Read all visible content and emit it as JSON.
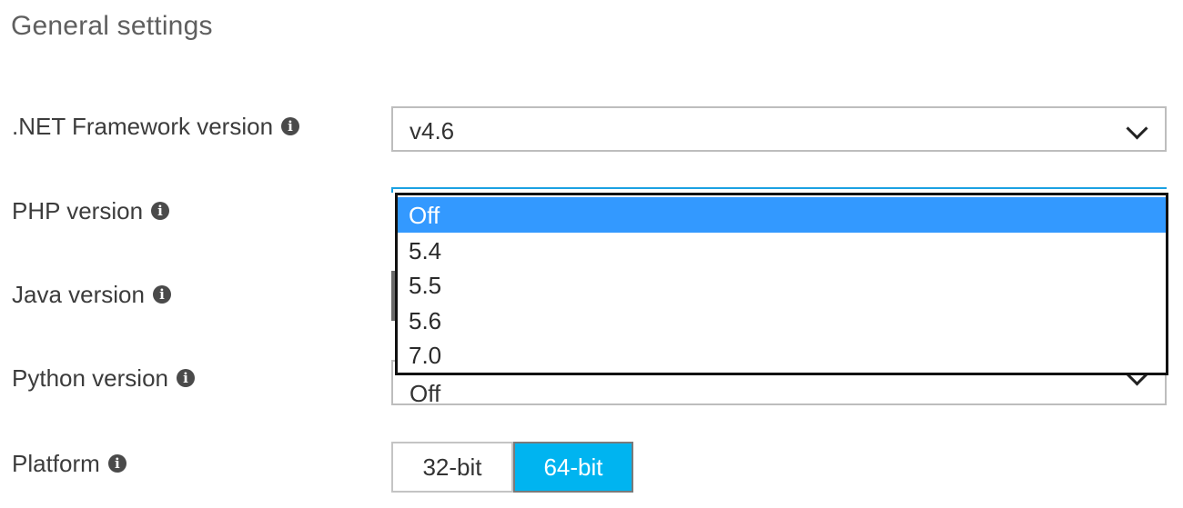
{
  "section": {
    "title": "General settings"
  },
  "fields": {
    "net": {
      "label": ".NET Framework version",
      "value": "v4.6"
    },
    "php": {
      "label": "PHP version",
      "options": [
        "Off",
        "5.4",
        "5.5",
        "5.6",
        "7.0"
      ],
      "highlighted": "Off"
    },
    "java": {
      "label": "Java version"
    },
    "python": {
      "label": "Python version",
      "value": "Off"
    },
    "platform": {
      "label": "Platform",
      "options": [
        "32-bit",
        "64-bit"
      ],
      "selected": "64-bit"
    }
  },
  "icons": {
    "info": "info-circle-icon",
    "dropdown": "chevron-down-icon"
  },
  "colors": {
    "accent": "#00b4f0",
    "dropdown_highlight": "#3399ff",
    "focus_border": "#1ba1e2"
  }
}
